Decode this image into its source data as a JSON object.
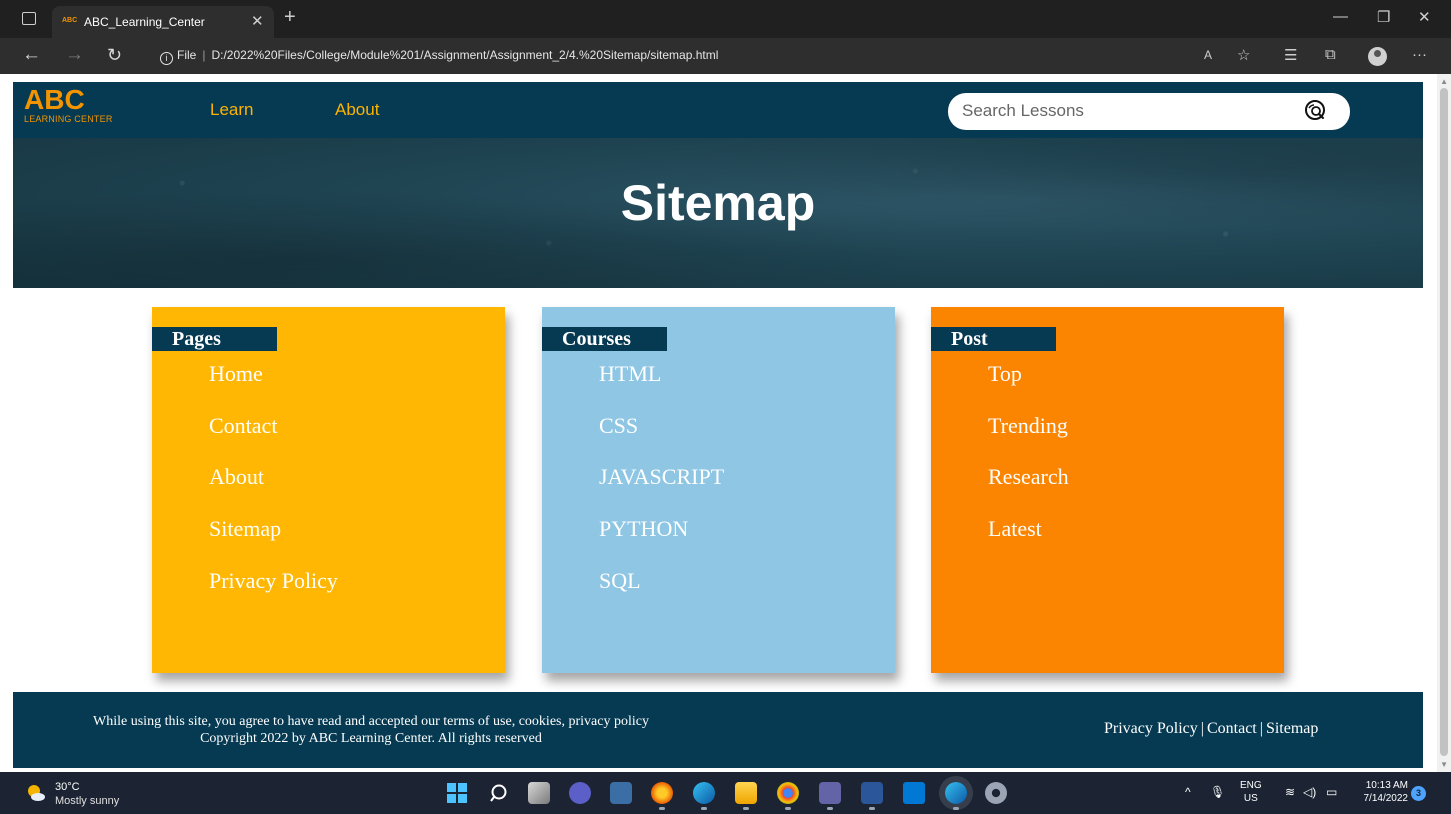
{
  "browser": {
    "tab_title": "ABC_Learning_Center",
    "tab_favicon_text": "ABC",
    "address_scheme_label": "File",
    "address_url": "D:/2022%20Files/College/Module%201/Assignment/Assignment_2/4.%20Sitemap/sitemap.html"
  },
  "site": {
    "logo_main": "ABC",
    "logo_sub": "LEARNING CENTER",
    "nav": [
      {
        "label": "Learn"
      },
      {
        "label": "About"
      }
    ],
    "search_placeholder": "Search Lessons",
    "hero_title": "Sitemap",
    "columns": [
      {
        "heading": "Pages",
        "color": "#ffb703",
        "links": [
          "Home",
          "Contact",
          "About",
          "Sitemap",
          "Privacy Policy"
        ]
      },
      {
        "heading": "Courses",
        "color": "#8ec6e4",
        "links": [
          "HTML",
          "CSS",
          "JAVASCRIPT",
          "PYTHON",
          "SQL"
        ]
      },
      {
        "heading": "Post",
        "color": "#fb8500",
        "links": [
          "Top",
          "Trending",
          "Research",
          "Latest"
        ]
      }
    ],
    "footer": {
      "notice_line1": "While using this site, you agree to have read and accepted our terms of use, cookies, privacy policy",
      "notice_line2": "Copyright 2022 by ABC Learning Center. All rights reserved",
      "links": [
        "Privacy Policy",
        "Contact",
        "Sitemap"
      ],
      "separator": "|"
    },
    "colors": {
      "navy": "#063a52",
      "accent_orange": "#f29400",
      "nav_yellow": "#ffb300"
    }
  },
  "taskbar": {
    "weather_temp": "30°C",
    "weather_desc": "Mostly sunny",
    "lang_primary": "ENG",
    "lang_secondary": "US",
    "time": "10:13 AM",
    "date": "7/14/2022",
    "notification_count": "3"
  }
}
